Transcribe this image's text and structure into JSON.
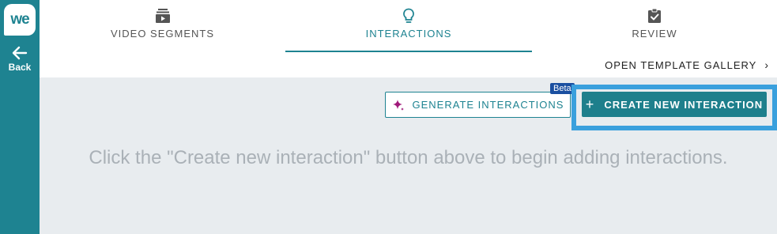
{
  "sidebar": {
    "logo_text": "we",
    "back_label": "Back"
  },
  "tabs": [
    {
      "label": "VIDEO SEGMENTS",
      "icon": "video-segments-icon"
    },
    {
      "label": "INTERACTIONS",
      "icon": "lightbulb-icon",
      "active": true
    },
    {
      "label": "REVIEW",
      "icon": "clipboard-check-icon"
    }
  ],
  "gallery_link": {
    "label": "OPEN TEMPLATE GALLERY",
    "icon": "chevron-right-icon"
  },
  "actions": {
    "generate_label": "GENERATE INTERACTIONS",
    "beta_label": "Beta",
    "create_label": "CREATE NEW INTERACTION",
    "create_icon_text": "+"
  },
  "empty_state": {
    "message": "Click the \"Create new interaction\" button above to begin adding interactions."
  },
  "colors": {
    "brand": "#1e8391",
    "highlight": "#3aa0dd",
    "beta": "#1a4fa0",
    "sparkle": "#a0197a"
  }
}
